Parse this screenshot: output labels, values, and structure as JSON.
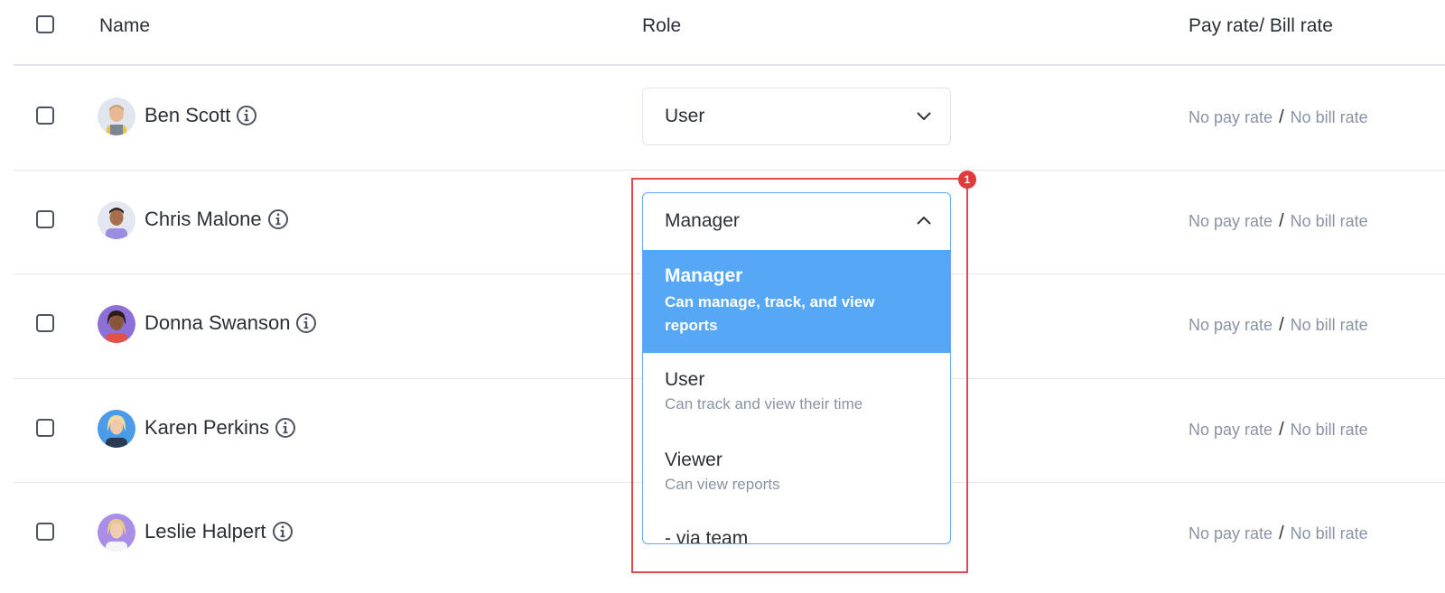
{
  "table": {
    "headers": {
      "name": "Name",
      "role": "Role",
      "rate": "Pay rate/ Bill rate"
    },
    "rows": [
      {
        "name": "Ben Scott",
        "role": "User",
        "pay_rate": "No pay rate",
        "separator": "/",
        "bill_rate": "No bill rate",
        "avatar": "avatar-ben-scott"
      },
      {
        "name": "Chris Malone",
        "role": "Manager",
        "pay_rate": "No pay rate",
        "separator": "/",
        "bill_rate": "No bill rate",
        "avatar": "avatar-chris-malone"
      },
      {
        "name": "Donna Swanson",
        "pay_rate": "No pay rate",
        "separator": "/",
        "bill_rate": "No bill rate",
        "avatar": "avatar-donna-swanson"
      },
      {
        "name": "Karen Perkins",
        "pay_rate": "No pay rate",
        "separator": "/",
        "bill_rate": "No bill rate",
        "avatar": "avatar-karen-perkins"
      },
      {
        "name": "Leslie Halpert",
        "pay_rate": "No pay rate",
        "separator": "/",
        "bill_rate": "No bill rate",
        "avatar": "avatar-leslie-halpert"
      }
    ]
  },
  "role_dropdown": {
    "options": [
      {
        "title": "Manager",
        "description": "Can manage, track, and view reports",
        "selected": true
      },
      {
        "title": "User",
        "description": "Can track and view their time"
      },
      {
        "title": "Viewer",
        "description": "Can view reports"
      },
      {
        "title": "- via team"
      }
    ]
  },
  "annotation": {
    "badge": "1",
    "color": "#e04a4a"
  },
  "icons": {
    "info": "info-circle-icon",
    "chevron_down": "chevron-down-icon",
    "chevron_up": "chevron-up-icon"
  },
  "colors": {
    "selected_option_bg": "#57a7f7",
    "muted_text": "#8a93a3",
    "focus_border": "#62a7f5"
  }
}
